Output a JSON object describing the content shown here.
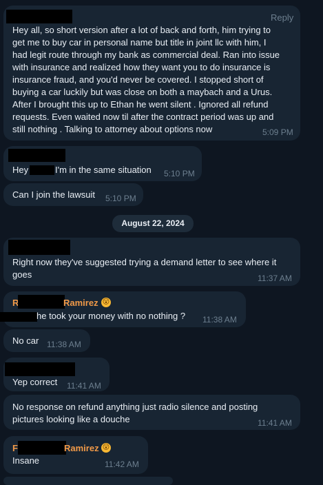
{
  "messages": {
    "m1": {
      "reply": "Reply",
      "lines": [
        "Hey all, so short version after a lot of back and forth, him trying to",
        "get me to buy car in personal name but title in joint llc with him, I",
        "had legit route through my bank as commercial deal. Ran into issue",
        "with insurance and realized how they want you to do insurance is",
        "insurance fraud, and you'd never be covered. I stopped short of",
        "buying a car luckily but was close on both a maybach and a Urus.",
        "After I brought this up to Ethan he went silent . Ignored all refund",
        "requests. Even waited now til after the contract period was up and",
        "still nothing . Talking to attorney about options  now"
      ],
      "time": "5:09 PM"
    },
    "m2": {
      "text_a": "Hey",
      "text_b": "I'm in the same situation",
      "time": "5:10 PM"
    },
    "m3": {
      "text": "Can I join the lawsuit",
      "time": "5:10 PM"
    },
    "date_separator": "August 22, 2024",
    "m4": {
      "lines": [
        "Right now they've suggested trying a demand letter to see where it",
        "goes"
      ],
      "time": "11:37 AM"
    },
    "m5": {
      "sender_partial": "Ramirez",
      "emoji": "😮",
      "text": "he took your money with no nothing ?",
      "time": "11:38 AM"
    },
    "m6": {
      "text": "No car",
      "time": "11:38 AM"
    },
    "m7": {
      "text": "Yep correct",
      "time": "11:41 AM"
    },
    "m8": {
      "lines": [
        "No response on refund anything just radio silence and posting",
        "pictures looking like a douche"
      ],
      "time": "11:41 AM"
    },
    "m9": {
      "sender_partial": "Ramirez",
      "emoji": "😮",
      "text": "Insane",
      "time": "11:42 AM"
    }
  }
}
